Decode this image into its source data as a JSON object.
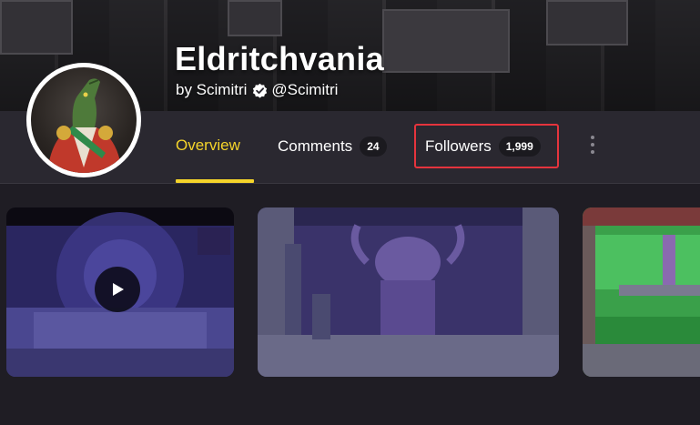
{
  "header": {
    "title": "Eldritchvania",
    "by_label": "by Scimitri",
    "handle": "@Scimitri"
  },
  "tabs": [
    {
      "label": "Overview",
      "active": true
    },
    {
      "label": "Comments",
      "count": "24"
    },
    {
      "label": "Followers",
      "count": "1,999"
    }
  ],
  "colors": {
    "accent": "#f5d42a",
    "highlight": "#e5343d",
    "navbar": "#2a2830",
    "background": "#1f1d24"
  },
  "icons": {
    "verified": "verified-badge-icon",
    "more": "kebab-menu-icon",
    "play": "play-icon"
  }
}
